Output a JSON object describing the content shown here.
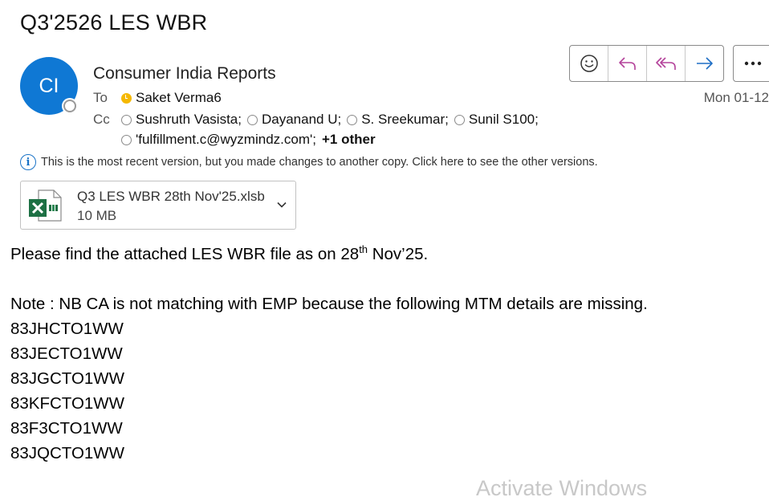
{
  "subject": "Q3'2526 LES WBR",
  "sender": {
    "initials": "CI",
    "name": "Consumer India Reports"
  },
  "to": {
    "label": "To",
    "recipients": [
      {
        "name": "Saket Verma6"
      }
    ]
  },
  "cc": {
    "label": "Cc",
    "recipients": [
      {
        "name": "Sushruth Vasista;"
      },
      {
        "name": "Dayanand U;"
      },
      {
        "name": "S. Sreekumar;"
      },
      {
        "name": "Sunil S100;"
      },
      {
        "name": "'fulfillment.c@wyzmindz.com';"
      }
    ],
    "more_label": "+1 other"
  },
  "date": "Mon 01-12",
  "info_bar": {
    "text": "This is the most recent version, but you made changes to another copy. Click here to see the other versions."
  },
  "attachment": {
    "filename": "Q3 LES WBR 28th Nov'25.xlsb",
    "size": "10 MB",
    "icon": "excel-icon"
  },
  "actions": [
    {
      "name": "emoji-icon"
    },
    {
      "name": "reply-icon"
    },
    {
      "name": "reply-all-icon"
    },
    {
      "name": "forward-icon"
    },
    {
      "name": "more-icon"
    }
  ],
  "body": {
    "line1_before": "Please find the attached LES WBR file as on 28",
    "line1_sup": "th",
    "line1_after": " Nov’25.",
    "note": "Note : NB CA is not matching with EMP because the following MTM details are missing.",
    "mtm_list": [
      "83JHCTO1WW",
      "83JECTO1WW",
      "83JGCTO1WW",
      "83KFCTO1WW",
      "83F3CTO1WW",
      "83JQCTO1WW"
    ]
  },
  "watermark": "Activate Windows",
  "colors": {
    "avatar": "#0f78d4",
    "reply_accent": "#b4439b",
    "forward_accent": "#1f6fc5",
    "excel_green": "#1d7044",
    "away_yellow": "#f5b800"
  }
}
